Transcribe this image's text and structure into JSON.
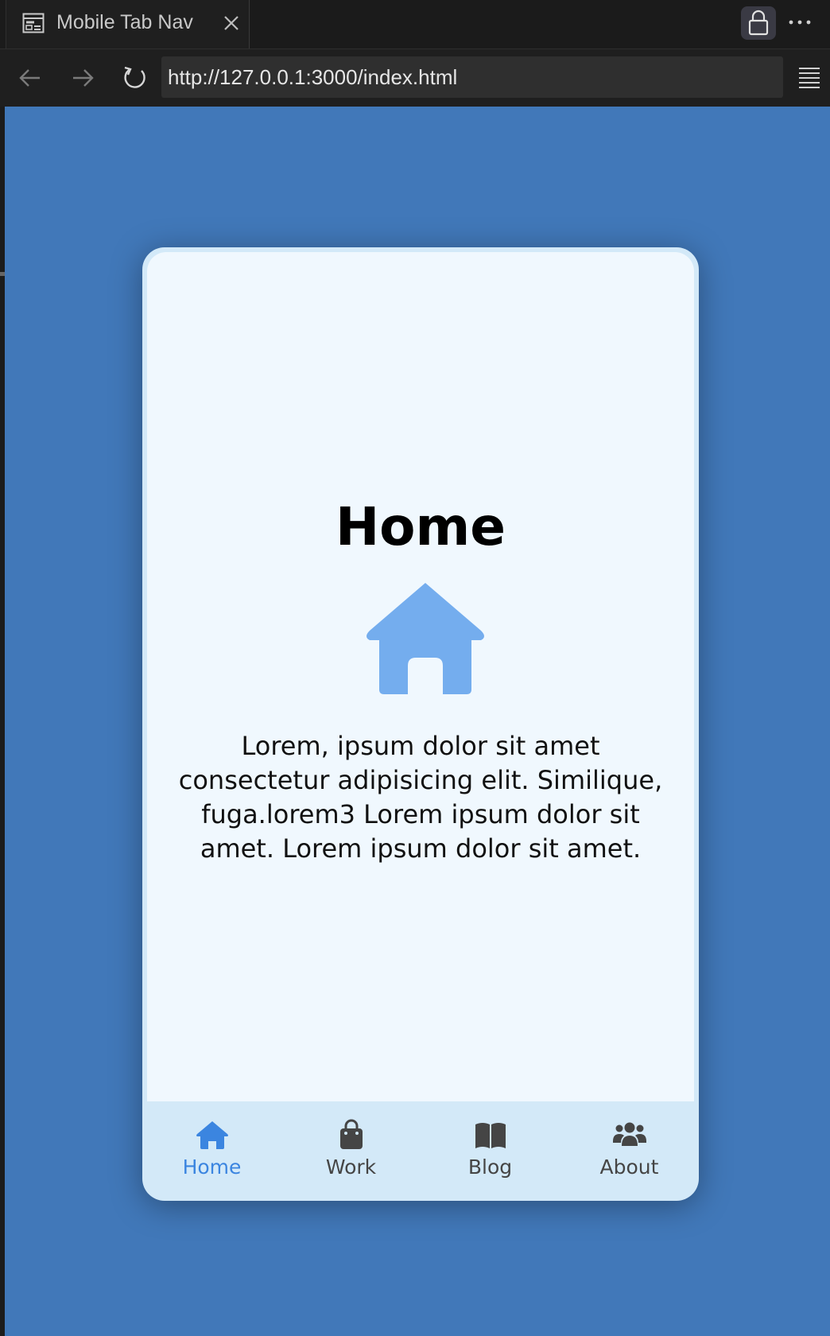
{
  "browser": {
    "tab_title": "Mobile Tab Nav",
    "url": "http://127.0.0.1:3000/index.html"
  },
  "page": {
    "heading": "Home",
    "hero_icon": "house-icon",
    "body": "Lorem, ipsum dolor sit amet consectetur adipisicing elit. Similique, fuga.lorem3 Lorem ipsum dolor sit amet. Lorem ipsum dolor sit amet."
  },
  "tab_nav": {
    "items": [
      {
        "label": "Home",
        "icon": "house-icon",
        "active": true
      },
      {
        "label": "Work",
        "icon": "briefcase-icon",
        "active": false
      },
      {
        "label": "Blog",
        "icon": "book-icon",
        "active": false
      },
      {
        "label": "About",
        "icon": "users-icon",
        "active": false
      }
    ]
  },
  "colors": {
    "page_background": "#4178b9",
    "phone_frame": "#d3e9f8",
    "content_background": "#f0f8fe",
    "active_tab": "#3b85e0",
    "inactive_tab": "#454545",
    "hero_icon": "#74adee"
  }
}
